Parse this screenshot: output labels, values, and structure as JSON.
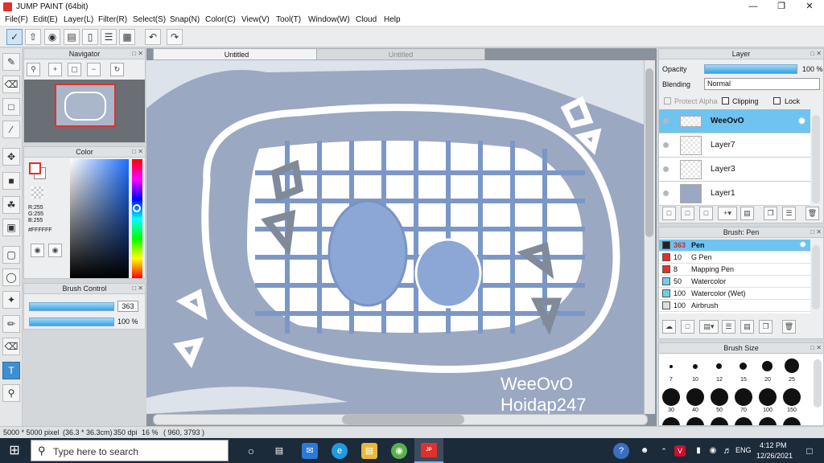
{
  "window": {
    "title": "JUMP PAINT (64bit)"
  },
  "menu": [
    "File(F)",
    "Edit(E)",
    "Layer(L)",
    "Filter(R)",
    "Select(S)",
    "Snap(N)",
    "Color(C)",
    "View(V)",
    "Tool(T)",
    "Window(W)",
    "Cloud",
    "Help"
  ],
  "tabs": {
    "active": "Untitled",
    "inactive": "Untitled"
  },
  "navigator": {
    "title": "Navigator"
  },
  "color": {
    "title": "Color",
    "r": "R:255",
    "g": "G:255",
    "b": "B:255",
    "hex": "#FFFFFF",
    "foreground": "#e0302d",
    "background": "#ffffff"
  },
  "brush_control": {
    "title": "Brush Control",
    "size": "363",
    "opacity": "100 %",
    "size_fill": 1.0,
    "opacity_fill": 1.0
  },
  "layer": {
    "title": "Layer",
    "opacity_label": "Opacity",
    "opacity_value": "100 %",
    "blending_label": "Blending",
    "blending_value": "Normal",
    "protect_alpha": "Protect Alpha",
    "clipping": "Clipping",
    "lock": "Lock",
    "layers": [
      "WeeOvO",
      "Layer7",
      "Layer3",
      "Layer1"
    ]
  },
  "brush": {
    "title": "Brush: Pen",
    "items": [
      {
        "size": "363",
        "name": "Pen",
        "color": "#222222"
      },
      {
        "size": "10",
        "name": "G Pen",
        "color": "#e0302d"
      },
      {
        "size": "8",
        "name": "Mapping Pen",
        "color": "#e0302d"
      },
      {
        "size": "50",
        "name": "Watercolor",
        "color": "#6fd0e8"
      },
      {
        "size": "100",
        "name": "Watercolor (Wet)",
        "color": "#6fd0e8"
      },
      {
        "size": "100",
        "name": "Airbrush",
        "color": "#dddddd"
      }
    ]
  },
  "brush_size": {
    "title": "Brush Size",
    "sizes": [
      "7",
      "10",
      "12",
      "15",
      "20",
      "25",
      "30",
      "40",
      "50",
      "70",
      "100",
      "150"
    ]
  },
  "canvas_text": {
    "line1": "WeeOvO",
    "line2": "Hoidap247"
  },
  "status": {
    "pixels": "5000 * 5000 pixel",
    "dims": "(36.3 * 36.3cm)",
    "dpi": "350 dpi",
    "zoom": "16 %",
    "coords": "( 960, 3793 )"
  },
  "taskbar": {
    "search_placeholder": "Type here to search",
    "lang": "ENG",
    "time": "4:12 PM",
    "date": "12/26/2021"
  }
}
